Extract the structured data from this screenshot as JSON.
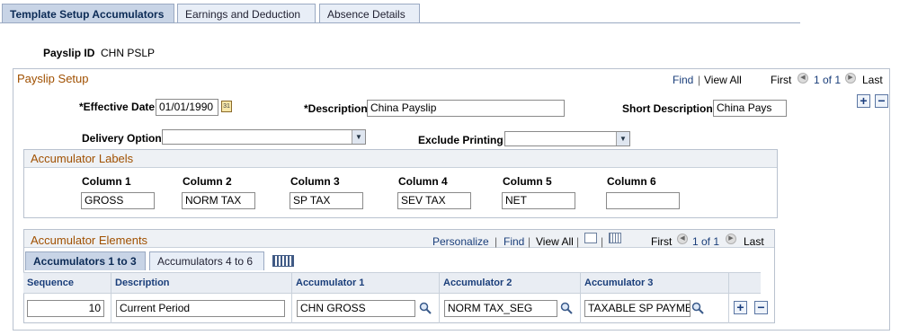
{
  "tabs": [
    {
      "label": "Template Setup Accumulators",
      "active": true
    },
    {
      "label": "Earnings and Deduction",
      "active": false
    },
    {
      "label": "Absence Details",
      "active": false
    }
  ],
  "payslip_id": {
    "label": "Payslip ID",
    "value": "CHN PSLP"
  },
  "payslip_setup": {
    "title": "Payslip Setup",
    "nav": {
      "find": "Find",
      "view_all": "View All",
      "first": "First",
      "count": "1 of 1",
      "last": "Last"
    },
    "effective_date": {
      "label": "*Effective Date",
      "value": "01/01/1990"
    },
    "description": {
      "label": "*Description",
      "value": "China Payslip"
    },
    "short_description": {
      "label": "Short Description",
      "value": "China Pays"
    },
    "delivery_option": {
      "label": "Delivery Option",
      "value": ""
    },
    "exclude_printing": {
      "label": "Exclude Printing",
      "value": ""
    }
  },
  "accumulator_labels": {
    "title": "Accumulator Labels",
    "columns": [
      {
        "label": "Column 1",
        "value": "GROSS"
      },
      {
        "label": "Column 2",
        "value": "NORM TAX"
      },
      {
        "label": "Column 3",
        "value": "SP TAX"
      },
      {
        "label": "Column 4",
        "value": "SEV TAX"
      },
      {
        "label": "Column 5",
        "value": "NET"
      },
      {
        "label": "Column 6",
        "value": ""
      }
    ]
  },
  "accumulator_elements": {
    "title": "Accumulator Elements",
    "nav": {
      "personalize": "Personalize",
      "find": "Find",
      "view_all": "View All",
      "first": "First",
      "count": "1 of 1",
      "last": "Last"
    },
    "tabs": [
      {
        "label": "Accumulators 1 to 3",
        "active": true
      },
      {
        "label": "Accumulators 4 to 6",
        "active": false
      }
    ],
    "headers": [
      "Sequence",
      "Description",
      "Accumulator 1",
      "Accumulator 2",
      "Accumulator 3"
    ],
    "row": {
      "sequence": "10",
      "description": "Current Period",
      "acc1": "CHN GROSS",
      "acc2": "NORM TAX_SEG",
      "acc3": "TAXABLE SP PAYMEI"
    }
  },
  "icons": {
    "add": "+",
    "remove": "−"
  }
}
